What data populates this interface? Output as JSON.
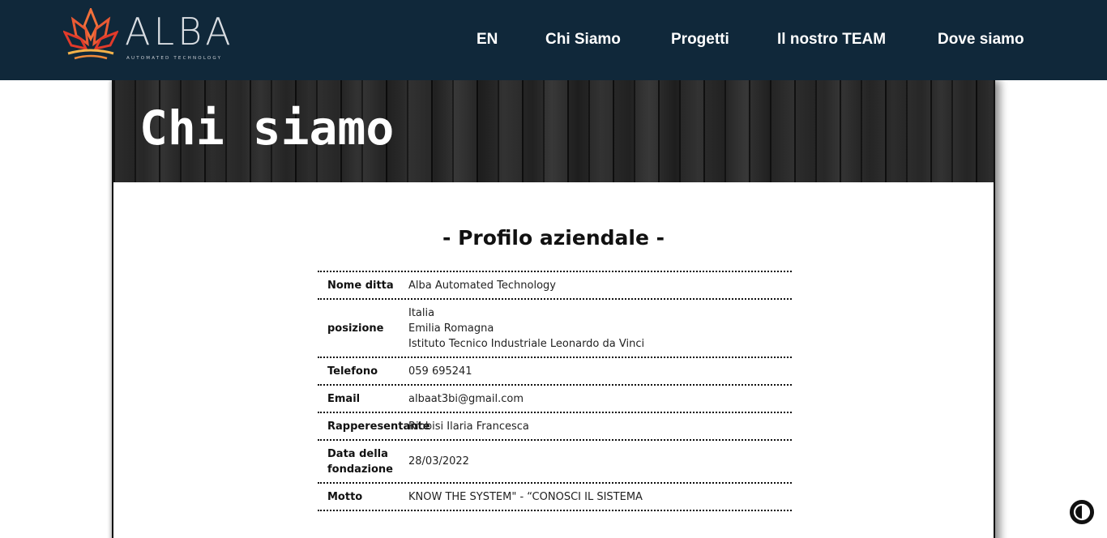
{
  "brand": {
    "name": "ALBA",
    "tagline": "AUTOMATED TECHNOLOGY",
    "mark_colors": [
      "#f2703a",
      "#e23a2a",
      "#f4b24a"
    ]
  },
  "nav": {
    "items": [
      {
        "label": "EN"
      },
      {
        "label": "Chi Siamo"
      },
      {
        "label": "Progetti"
      },
      {
        "label": "Il nostro TEAM"
      },
      {
        "label": "Dove siamo"
      }
    ]
  },
  "hero": {
    "title": "Chi siamo"
  },
  "profile": {
    "title": "- Profilo aziendale -",
    "rows": [
      {
        "label": "Nome ditta",
        "values": [
          "Alba Automated Technology"
        ]
      },
      {
        "label": "posizione",
        "values": [
          "Italia",
          "Emilia Romagna",
          "Istituto Tecnico Industriale Leonardo da Vinci"
        ]
      },
      {
        "label": "Telefono",
        "values": [
          "059 695241"
        ]
      },
      {
        "label": "Email",
        "values": [
          "albaat3bi@gmail.com"
        ]
      },
      {
        "label": "Rapperesentante",
        "values": [
          "Ribbisi Ilaria Francesca"
        ]
      },
      {
        "label_lines": [
          "Data della",
          "fondazione"
        ],
        "values": [
          "28/03/2022"
        ]
      },
      {
        "label": "Motto",
        "values": [
          "KNOW THE SYSTEM\" - “CONOSCI IL SISTEMA"
        ]
      }
    ]
  },
  "theme": {
    "navbar_bg": "#10283a",
    "contrast_icon": "contrast-icon"
  }
}
